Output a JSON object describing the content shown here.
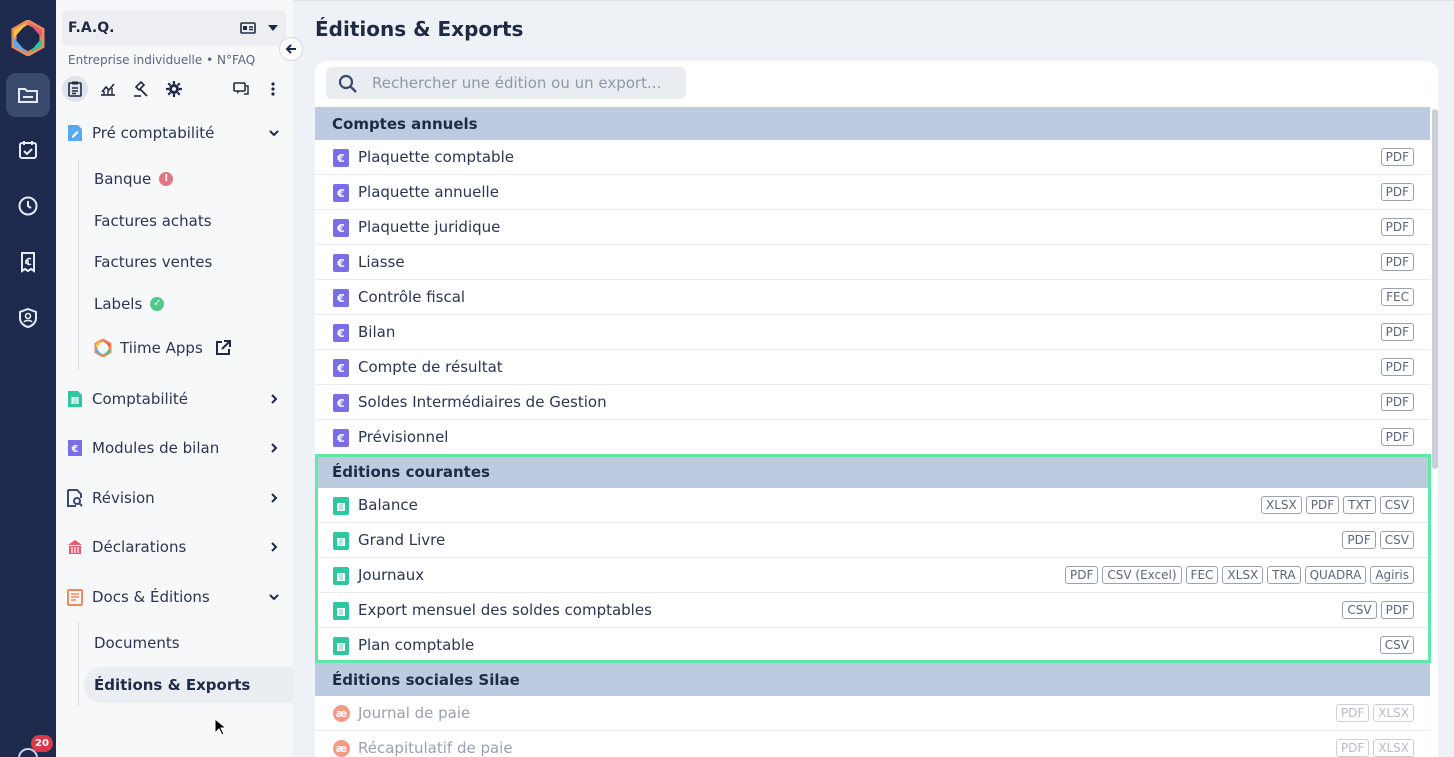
{
  "app": {
    "company_name": "F.A.Q.",
    "company_sub": "Entreprise individuelle  •  N°FAQ",
    "notifications_count": "20"
  },
  "rail": {
    "items": [
      {
        "name": "folder-icon",
        "active": true
      },
      {
        "name": "calendar-check-icon",
        "active": false
      },
      {
        "name": "clock-icon",
        "active": false
      },
      {
        "name": "receipt-euro-icon",
        "active": false
      },
      {
        "name": "user-shield-icon",
        "active": false
      }
    ]
  },
  "sidebar": {
    "tools": [
      "clipboard-icon",
      "chart-icon",
      "gavel-icon",
      "gear-icon",
      "chat-icon",
      "more-vertical-icon"
    ],
    "sections": [
      {
        "label": "Pré comptabilité",
        "color": "#5aa9f0",
        "expanded": true
      },
      {
        "label": "Comptabilité",
        "color": "#2fc7a0",
        "expanded": false
      },
      {
        "label": "Modules de bilan",
        "color": "#7a6ee8",
        "expanded": false
      },
      {
        "label": "Révision",
        "color": "#3a4a6e",
        "expanded": false
      },
      {
        "label": "Déclarations",
        "color": "#e85a6e",
        "expanded": false
      },
      {
        "label": "Docs & Éditions",
        "color": "#f08a5a",
        "expanded": true
      }
    ],
    "pre_items": [
      {
        "label": "Banque",
        "status": "!"
      },
      {
        "label": "Factures achats"
      },
      {
        "label": "Factures ventes"
      },
      {
        "label": "Labels",
        "status": "ok"
      },
      {
        "label": "Tiime Apps"
      }
    ],
    "docs_items": [
      {
        "label": "Documents"
      },
      {
        "label": "Éditions & Exports",
        "active": true
      }
    ]
  },
  "main": {
    "title": "Éditions & Exports",
    "search_placeholder": "Rechercher une édition ou un export...",
    "sections": [
      {
        "title": "Comptes annuels",
        "icon_color": "#7a6ee8",
        "rows": [
          {
            "label": "Plaquette comptable",
            "tags": [
              "PDF"
            ]
          },
          {
            "label": "Plaquette annuelle",
            "tags": [
              "PDF"
            ]
          },
          {
            "label": "Plaquette juridique",
            "tags": [
              "PDF"
            ]
          },
          {
            "label": "Liasse",
            "tags": [
              "PDF"
            ]
          },
          {
            "label": "Contrôle fiscal",
            "tags": [
              "FEC"
            ]
          },
          {
            "label": "Bilan",
            "tags": [
              "PDF"
            ]
          },
          {
            "label": "Compte de résultat",
            "tags": [
              "PDF"
            ]
          },
          {
            "label": "Soldes Intermédiaires de Gestion",
            "tags": [
              "PDF"
            ]
          },
          {
            "label": "Prévisionnel",
            "tags": [
              "PDF"
            ]
          }
        ]
      },
      {
        "title": "Éditions courantes",
        "icon_color": "#2fc7a0",
        "rows": [
          {
            "label": "Balance",
            "tags": [
              "XLSX",
              "PDF",
              "TXT",
              "CSV"
            ]
          },
          {
            "label": "Grand Livre",
            "tags": [
              "PDF",
              "CSV"
            ]
          },
          {
            "label": "Journaux",
            "tags": [
              "PDF",
              "CSV (Excel)",
              "FEC",
              "XLSX",
              "TRA",
              "QUADRA",
              "Agiris"
            ]
          },
          {
            "label": "Export mensuel des soldes comptables",
            "tags": [
              "CSV",
              "PDF"
            ]
          },
          {
            "label": "Plan comptable",
            "tags": [
              "CSV"
            ]
          }
        ]
      },
      {
        "title": "Éditions sociales Silae",
        "icon_color": "#f39a85",
        "muted": true,
        "rows": [
          {
            "label": "Journal de paie",
            "tags": [
              "PDF",
              "XLSX"
            ]
          },
          {
            "label": "Récapitulatif de paie",
            "tags": [
              "PDF",
              "XLSX"
            ]
          }
        ]
      }
    ]
  },
  "colors": {
    "rail_bg": "#1d2a4d",
    "section_header_bg": "#bccbdf",
    "highlight": "#5fe8a6"
  }
}
